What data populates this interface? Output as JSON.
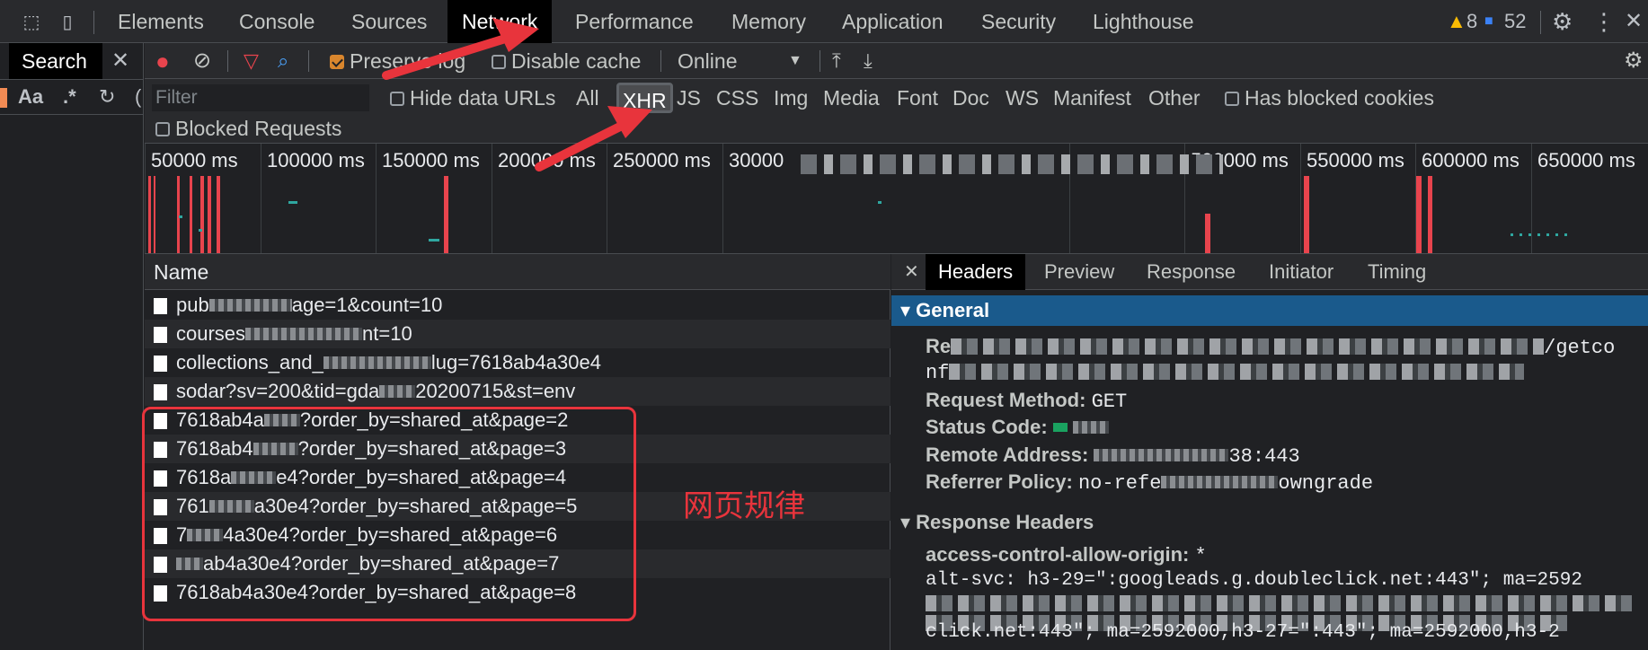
{
  "topbar": {
    "tabs": [
      "Elements",
      "Console",
      "Sources",
      "Network",
      "Performance",
      "Memory",
      "Application",
      "Security",
      "Lighthouse"
    ],
    "active_tab": "Network",
    "warnings": "8",
    "messages": "52"
  },
  "search_drawer": {
    "title": "Search",
    "match_case": "Aa",
    "regex": ".*"
  },
  "toolbar": {
    "preserve_log": "Preserve log",
    "disable_cache": "Disable cache",
    "throttling": "Online"
  },
  "filterbar": {
    "placeholder": "Filter",
    "hide_data_urls": "Hide data URLs",
    "types": [
      "All",
      "XHR",
      "JS",
      "CSS",
      "Img",
      "Media",
      "Font",
      "Doc",
      "WS",
      "Manifest",
      "Other"
    ],
    "selected_type": "XHR",
    "has_blocked_cookies": "Has blocked cookies",
    "blocked_requests": "Blocked Requests"
  },
  "timeline": {
    "ticks": [
      "50000 ms",
      "100000 ms",
      "150000 ms",
      "200000 ms",
      "250000 ms",
      "30000",
      "500000 ms",
      "550000 ms",
      "600000 ms",
      "650000 ms"
    ]
  },
  "request_list": {
    "column_name": "Name",
    "rows": [
      {
        "prefix": "pub",
        "suffix": "age=1&count=10"
      },
      {
        "prefix": "courses",
        "suffix": "nt=10"
      },
      {
        "prefix": "collections_and_",
        "suffix": "lug=7618ab4a30e4"
      },
      {
        "prefix": "sodar?sv=200&tid=gda",
        "suffix": "20200715&st=env"
      },
      {
        "prefix": "7618ab4a",
        "suffix": "?order_by=shared_at&page=2"
      },
      {
        "prefix": "7618ab4",
        "suffix": "?order_by=shared_at&page=3"
      },
      {
        "prefix": "7618a",
        "suffix": "e4?order_by=shared_at&page=4"
      },
      {
        "prefix": "761",
        "suffix": "a30e4?order_by=shared_at&page=5"
      },
      {
        "prefix": "7",
        "suffix": "4a30e4?order_by=shared_at&page=6"
      },
      {
        "prefix": "",
        "suffix": "ab4a30e4?order_by=shared_at&page=7"
      },
      {
        "prefix": "",
        "suffix": "7618ab4a30e4?order_by=shared_at&page=8"
      }
    ]
  },
  "annotation": "网页规律",
  "details": {
    "tabs": [
      "Headers",
      "Preview",
      "Response",
      "Initiator",
      "Timing"
    ],
    "active_tab": "Headers",
    "general": {
      "title": "General",
      "request_url_label": "Re",
      "request_url_tail": "/getco",
      "request_url_line2": "nf",
      "method_label": "Request Method:",
      "method_value": "GET",
      "status_label": "Status Code:",
      "remote_label": "Remote Address:",
      "remote_value": "38:443",
      "referrer_label": "Referrer Policy:",
      "referrer_value_start": "no-refe",
      "referrer_value_end": "owngrade"
    },
    "response_headers": {
      "title": "Response Headers",
      "acao_label": "access-control-allow-origin:",
      "acao_value": "*",
      "alt_svc_line1": "alt-svc: h3-29=\":googleads.g.doubleclick.net:443\"; ma=2592",
      "alt_svc_line3": "click.net:443\"; ma=2592000,h3-27=\":443\"; ma=2592000,h3-2"
    }
  },
  "colors": {
    "accent": "#e8343c",
    "general_bg": "#1a5a8c",
    "status_ok": "#1aa260"
  }
}
